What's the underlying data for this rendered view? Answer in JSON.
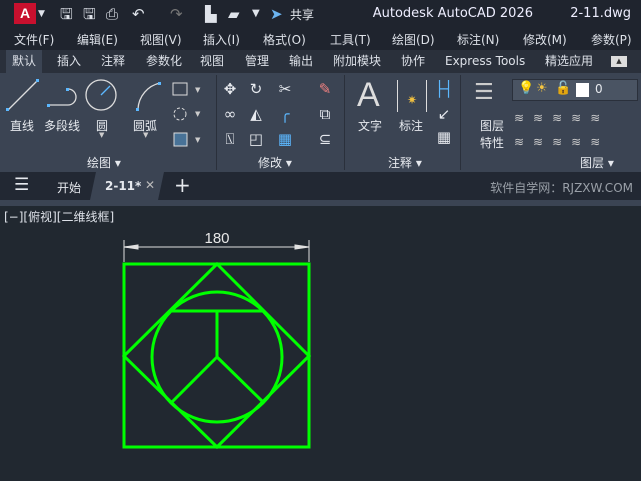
{
  "app": {
    "logo": "A",
    "title": "Autodesk AutoCAD 2026",
    "filename": "2-11.dwg",
    "share": "共享"
  },
  "quick_access": [
    "save-icon",
    "save-as-icon",
    "print-icon",
    "undo-icon",
    "redo-icon",
    "new-icon",
    "open-icon",
    "dropdown-icon",
    "share-icon"
  ],
  "menu": [
    "文件(F)",
    "编辑(E)",
    "视图(V)",
    "插入(I)",
    "格式(O)",
    "工具(T)",
    "绘图(D)",
    "标注(N)",
    "修改(M)",
    "参数(P)"
  ],
  "ribbon_tabs": [
    {
      "label": "默认",
      "active": true
    },
    {
      "label": "插入"
    },
    {
      "label": "注释"
    },
    {
      "label": "参数化"
    },
    {
      "label": "视图"
    },
    {
      "label": "管理"
    },
    {
      "label": "输出"
    },
    {
      "label": "附加模块"
    },
    {
      "label": "协作"
    },
    {
      "label": "Express Tools"
    },
    {
      "label": "精选应用"
    }
  ],
  "panels": {
    "draw": {
      "title": "绘图",
      "tools": [
        "直线",
        "多段线",
        "圆",
        "圆弧"
      ]
    },
    "modify": {
      "title": "修改"
    },
    "annotate": {
      "title": "注释",
      "tools": [
        "文字",
        "标注"
      ]
    },
    "layers": {
      "title": "图层",
      "properties": [
        "图层",
        "特性"
      ],
      "current_layer": "0"
    }
  },
  "doc_tabs": [
    {
      "label": "开始"
    },
    {
      "label": "2-11*",
      "active": true
    }
  ],
  "watermark": "软件自学网：RJZXW.COM",
  "viewport": {
    "label": "[−][俯视][二维线框]",
    "dimension": "180"
  },
  "colors": {
    "geometry": "#00ff00",
    "accent": "#c8102e",
    "dimension": "#e0e0e0"
  }
}
